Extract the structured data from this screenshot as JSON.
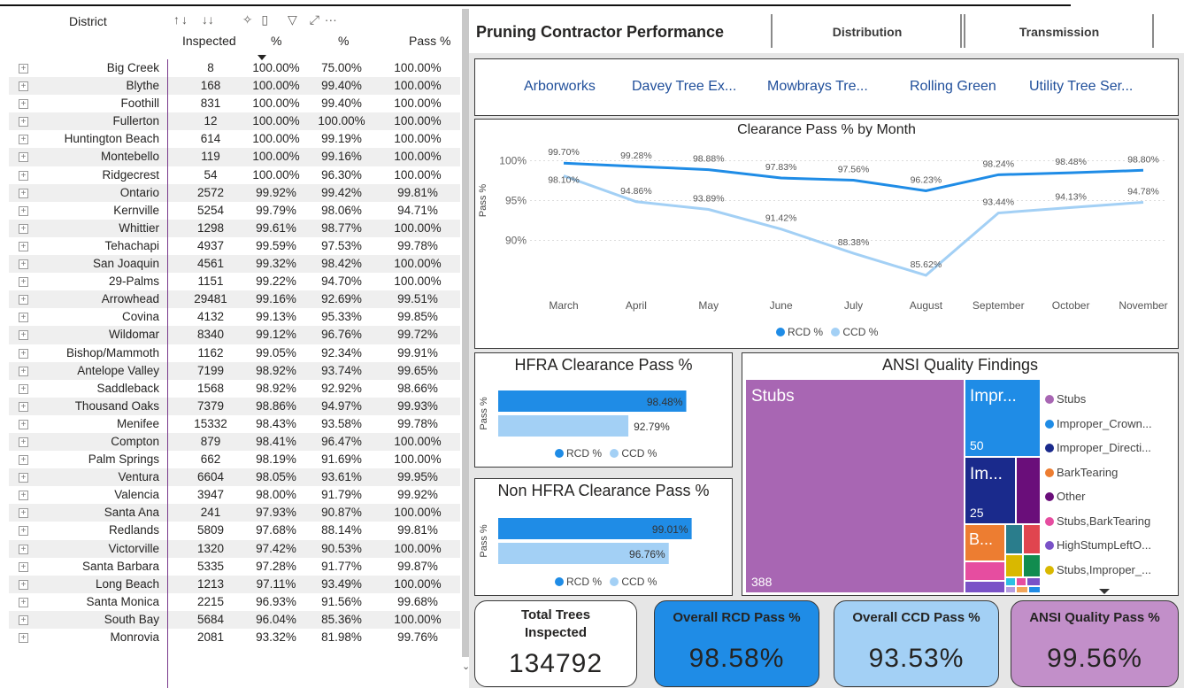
{
  "table": {
    "headers": {
      "district": "District",
      "inspected": "Inspected",
      "rcd": "%",
      "ccd": "%",
      "ansi": "Pass %"
    },
    "rows": [
      {
        "district": "Big Creek",
        "inspected": "8",
        "rcd": "100.00%",
        "ccd": "75.00%",
        "ansi": "100.00%"
      },
      {
        "district": "Blythe",
        "inspected": "168",
        "rcd": "100.00%",
        "ccd": "99.40%",
        "ansi": "100.00%"
      },
      {
        "district": "Foothill",
        "inspected": "831",
        "rcd": "100.00%",
        "ccd": "99.40%",
        "ansi": "100.00%"
      },
      {
        "district": "Fullerton",
        "inspected": "12",
        "rcd": "100.00%",
        "ccd": "100.00%",
        "ansi": "100.00%"
      },
      {
        "district": "Huntington Beach",
        "inspected": "614",
        "rcd": "100.00%",
        "ccd": "99.19%",
        "ansi": "100.00%"
      },
      {
        "district": "Montebello",
        "inspected": "119",
        "rcd": "100.00%",
        "ccd": "99.16%",
        "ansi": "100.00%"
      },
      {
        "district": "Ridgecrest",
        "inspected": "54",
        "rcd": "100.00%",
        "ccd": "96.30%",
        "ansi": "100.00%"
      },
      {
        "district": "Ontario",
        "inspected": "2572",
        "rcd": "99.92%",
        "ccd": "99.42%",
        "ansi": "99.81%"
      },
      {
        "district": "Kernville",
        "inspected": "5254",
        "rcd": "99.79%",
        "ccd": "98.06%",
        "ansi": "94.71%"
      },
      {
        "district": "Whittier",
        "inspected": "1298",
        "rcd": "99.61%",
        "ccd": "98.77%",
        "ansi": "100.00%"
      },
      {
        "district": "Tehachapi",
        "inspected": "4937",
        "rcd": "99.59%",
        "ccd": "97.53%",
        "ansi": "99.78%"
      },
      {
        "district": "San Joaquin",
        "inspected": "4561",
        "rcd": "99.32%",
        "ccd": "98.42%",
        "ansi": "100.00%"
      },
      {
        "district": "29-Palms",
        "inspected": "1151",
        "rcd": "99.22%",
        "ccd": "94.70%",
        "ansi": "100.00%"
      },
      {
        "district": "Arrowhead",
        "inspected": "29481",
        "rcd": "99.16%",
        "ccd": "92.69%",
        "ansi": "99.51%"
      },
      {
        "district": "Covina",
        "inspected": "4132",
        "rcd": "99.13%",
        "ccd": "95.33%",
        "ansi": "99.85%"
      },
      {
        "district": "Wildomar",
        "inspected": "8340",
        "rcd": "99.12%",
        "ccd": "96.76%",
        "ansi": "99.72%"
      },
      {
        "district": "Bishop/Mammoth",
        "inspected": "1162",
        "rcd": "99.05%",
        "ccd": "92.34%",
        "ansi": "99.91%"
      },
      {
        "district": "Antelope Valley",
        "inspected": "7199",
        "rcd": "98.92%",
        "ccd": "93.74%",
        "ansi": "99.65%"
      },
      {
        "district": "Saddleback",
        "inspected": "1568",
        "rcd": "98.92%",
        "ccd": "92.92%",
        "ansi": "98.66%"
      },
      {
        "district": "Thousand Oaks",
        "inspected": "7379",
        "rcd": "98.86%",
        "ccd": "94.97%",
        "ansi": "99.93%"
      },
      {
        "district": "Menifee",
        "inspected": "15332",
        "rcd": "98.43%",
        "ccd": "93.58%",
        "ansi": "99.78%"
      },
      {
        "district": "Compton",
        "inspected": "879",
        "rcd": "98.41%",
        "ccd": "96.47%",
        "ansi": "100.00%"
      },
      {
        "district": "Palm Springs",
        "inspected": "662",
        "rcd": "98.19%",
        "ccd": "91.69%",
        "ansi": "100.00%"
      },
      {
        "district": "Ventura",
        "inspected": "6604",
        "rcd": "98.05%",
        "ccd": "93.61%",
        "ansi": "99.95%"
      },
      {
        "district": "Valencia",
        "inspected": "3947",
        "rcd": "98.00%",
        "ccd": "91.79%",
        "ansi": "99.92%"
      },
      {
        "district": "Santa Ana",
        "inspected": "241",
        "rcd": "97.93%",
        "ccd": "90.87%",
        "ansi": "100.00%"
      },
      {
        "district": "Redlands",
        "inspected": "5809",
        "rcd": "97.68%",
        "ccd": "88.14%",
        "ansi": "99.81%"
      },
      {
        "district": "Victorville",
        "inspected": "1320",
        "rcd": "97.42%",
        "ccd": "90.53%",
        "ansi": "100.00%"
      },
      {
        "district": "Santa Barbara",
        "inspected": "5335",
        "rcd": "97.28%",
        "ccd": "91.77%",
        "ansi": "99.87%"
      },
      {
        "district": "Long Beach",
        "inspected": "1213",
        "rcd": "97.11%",
        "ccd": "93.49%",
        "ansi": "100.00%"
      },
      {
        "district": "Santa Monica",
        "inspected": "2215",
        "rcd": "96.93%",
        "ccd": "91.56%",
        "ansi": "99.68%"
      },
      {
        "district": "South Bay",
        "inspected": "5684",
        "rcd": "96.04%",
        "ccd": "85.36%",
        "ansi": "100.00%"
      },
      {
        "district": "Monrovia",
        "inspected": "2081",
        "rcd": "93.32%",
        "ccd": "81.98%",
        "ansi": "99.76%"
      }
    ]
  },
  "header": {
    "title": "Pruning Contractor Performance",
    "tabs": [
      "Distribution",
      "Transmission"
    ]
  },
  "slicer": {
    "items": [
      "Arborworks",
      "Davey Tree Ex...",
      "Mowbrays Tre...",
      "Rolling Green",
      "Utility Tree Ser..."
    ]
  },
  "colors": {
    "rcd": "#1f8ce6",
    "ccd": "#a3d0f5",
    "ansi": "#a866b3",
    "kpi_rcd_bg": "#1f8ce6",
    "kpi_ccd_bg": "#a3d0f5",
    "kpi_ansi_bg": "#c28fc9"
  },
  "chart_data": [
    {
      "type": "line",
      "title": "Clearance Pass % by Month",
      "ylabel": "Pass %",
      "x": [
        "March",
        "April",
        "May",
        "June",
        "July",
        "August",
        "September",
        "October",
        "November"
      ],
      "yticks": [
        "100%",
        "95%",
        "90%"
      ],
      "ylim": [
        83,
        102
      ],
      "series": [
        {
          "name": "RCD %",
          "values": [
            99.7,
            99.28,
            98.88,
            97.83,
            97.56,
            96.23,
            98.24,
            98.48,
            98.8
          ],
          "labels": [
            "99.70%",
            "99.28%",
            "98.88%",
            "97.83%",
            "97.56%",
            "96.23%",
            "98.24%",
            "98.48%",
            "98.80%"
          ]
        },
        {
          "name": "CCD %",
          "values": [
            98.1,
            94.86,
            93.89,
            91.42,
            88.38,
            85.62,
            93.44,
            94.13,
            94.78
          ],
          "labels": [
            "98.10%",
            "94.86%",
            "93.89%",
            "91.42%",
            "88.38%",
            "85.62%",
            "93.44%",
            "94.13%",
            "94.78%"
          ]
        }
      ]
    },
    {
      "type": "bar",
      "title": "HFRA Clearance Pass %",
      "ylabel": "Pass %",
      "series": [
        {
          "name": "RCD %",
          "value": 98.48,
          "label": "98.48%"
        },
        {
          "name": "CCD %",
          "value": 92.79,
          "label": "92.79%"
        }
      ]
    },
    {
      "type": "bar",
      "title": "Non HFRA Clearance Pass %",
      "ylabel": "Pass %",
      "series": [
        {
          "name": "RCD %",
          "value": 99.01,
          "label": "99.01%"
        },
        {
          "name": "CCD %",
          "value": 96.76,
          "label": "96.76%"
        }
      ]
    }
  ],
  "treemap": {
    "title": "ANSI Quality Findings",
    "tiles": [
      {
        "label": "Stubs",
        "value": "388",
        "color": "#a866b3"
      },
      {
        "label": "Impr...",
        "value": "50",
        "color": "#1f8ce6"
      },
      {
        "label": "Im...",
        "value": "25",
        "color": "#1a2a8c"
      }
    ],
    "small_label": "B...",
    "legend": [
      {
        "label": "Stubs",
        "color": "#a866b3"
      },
      {
        "label": "Improper_Crown...",
        "color": "#1f8ce6"
      },
      {
        "label": "Improper_Directi...",
        "color": "#1a2a8c"
      },
      {
        "label": "BarkTearing",
        "color": "#ed7d31"
      },
      {
        "label": "Other",
        "color": "#6a0e7a"
      },
      {
        "label": "Stubs,BarkTearing",
        "color": "#e64da0"
      },
      {
        "label": "HighStumpLeftO...",
        "color": "#7a52c7"
      },
      {
        "label": "Stubs,Improper_...",
        "color": "#d9b800"
      }
    ]
  },
  "kpis": [
    {
      "label": "Total Trees Inspected",
      "value": "134792"
    },
    {
      "label": "Overall RCD Pass %",
      "value": "98.58%"
    },
    {
      "label": "Overall CCD Pass %",
      "value": "93.53%"
    },
    {
      "label": "ANSI Quality Pass %",
      "value": "99.56%"
    }
  ]
}
